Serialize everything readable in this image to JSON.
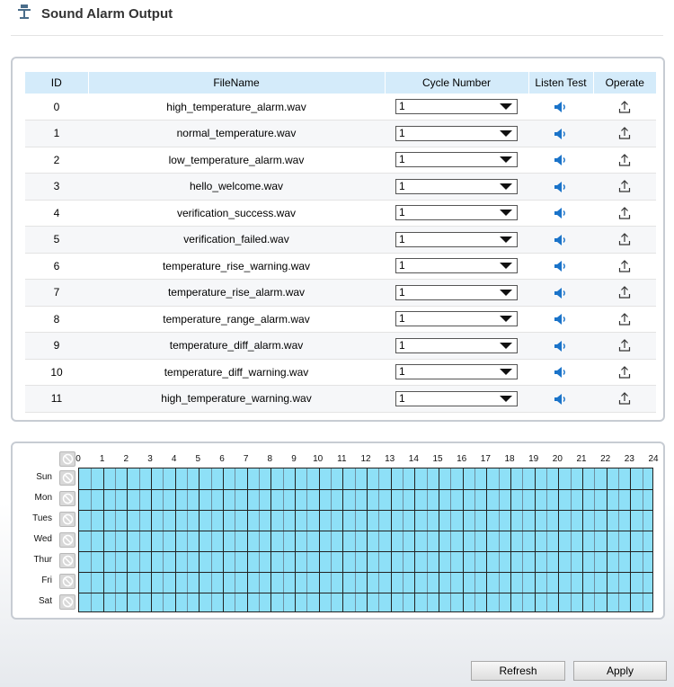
{
  "page": {
    "title": "Sound Alarm Output",
    "icon": "speaker-tower-icon"
  },
  "table": {
    "headers": [
      "ID",
      "FileName",
      "Cycle Number",
      "Listen Test",
      "Operate"
    ],
    "rows": [
      {
        "id": "0",
        "file": "high_temperature_alarm.wav",
        "cycle": "1"
      },
      {
        "id": "1",
        "file": "normal_temperature.wav",
        "cycle": "1"
      },
      {
        "id": "2",
        "file": "low_temperature_alarm.wav",
        "cycle": "1"
      },
      {
        "id": "3",
        "file": "hello_welcome.wav",
        "cycle": "1"
      },
      {
        "id": "4",
        "file": "verification_success.wav",
        "cycle": "1"
      },
      {
        "id": "5",
        "file": "verification_failed.wav",
        "cycle": "1"
      },
      {
        "id": "6",
        "file": "temperature_rise_warning.wav",
        "cycle": "1"
      },
      {
        "id": "7",
        "file": "temperature_rise_alarm.wav",
        "cycle": "1"
      },
      {
        "id": "8",
        "file": "temperature_range_alarm.wav",
        "cycle": "1"
      },
      {
        "id": "9",
        "file": "temperature_diff_alarm.wav",
        "cycle": "1"
      },
      {
        "id": "10",
        "file": "temperature_diff_warning.wav",
        "cycle": "1"
      },
      {
        "id": "11",
        "file": "high_temperature_warning.wav",
        "cycle": "1"
      }
    ],
    "listen_icon": "speaker-icon",
    "operate_icon": "upload-icon"
  },
  "schedule": {
    "hours": [
      "0",
      "1",
      "2",
      "3",
      "4",
      "5",
      "6",
      "7",
      "8",
      "9",
      "10",
      "11",
      "12",
      "13",
      "14",
      "15",
      "16",
      "17",
      "18",
      "19",
      "20",
      "21",
      "22",
      "23",
      "24"
    ],
    "days": [
      "Sun",
      "Mon",
      "Tues",
      "Wed",
      "Thur",
      "Fri",
      "Sat"
    ],
    "toggle_icon": "toggle-select-icon",
    "fill_color": "#8ee0f7",
    "all_selected": true
  },
  "buttons": {
    "refresh": "Refresh",
    "apply": "Apply"
  },
  "colors": {
    "header_bg": "#d4ebfa",
    "speaker": "#1a73c9",
    "schedule_fill": "#8ee0f7"
  }
}
